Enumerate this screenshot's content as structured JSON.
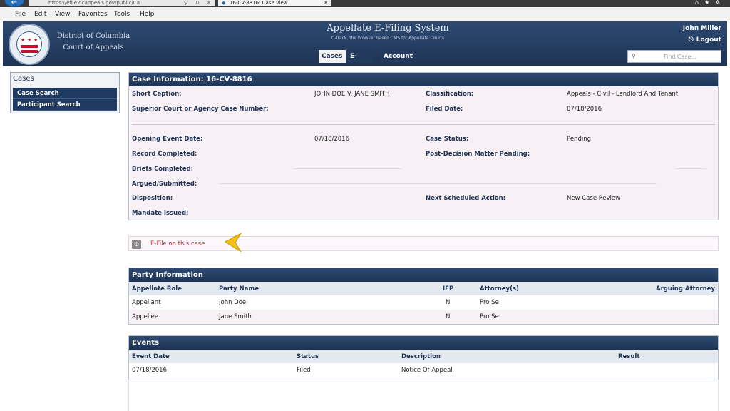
{
  "browser": {
    "address_text": "https://efile.dcappeals.gov/public/Ca",
    "tab_title": "16-CV-8816: Case View",
    "win_controls": "⌂★✲"
  },
  "menu": [
    "File",
    "Edit",
    "View",
    "Favorites",
    "Tools",
    "Help"
  ],
  "header": {
    "court_line1": "District of Columbia",
    "court_line2": "Court of Appeals",
    "app_title": "Appellate E-Filing System",
    "app_subtitle": "C-Track, the browser based CMS for Appellate Courts",
    "tabs": [
      "Cases",
      "E-Filing",
      "Account"
    ],
    "active_tab": "Cases",
    "user": "John Miller",
    "logout": "Logout",
    "find_case_placeholder": "Find Case..."
  },
  "sidebar": {
    "title": "Cases",
    "items": [
      "Case Search",
      "Participant Search"
    ]
  },
  "case_info": {
    "title": "Case Information: 16-CV-8816",
    "short_caption_label": "Short Caption:",
    "short_caption": "JOHN DOE V. JANE SMITH",
    "classification_label": "Classification:",
    "classification": "Appeals - Civil - Landlord And Tenant",
    "lower_court_label": "Superior Court or Agency Case Number:",
    "filed_date_label": "Filed Date:",
    "filed_date": "07/18/2016",
    "opening_event_label": "Opening Event Date:",
    "opening_event": "07/18/2016",
    "case_status_label": "Case Status:",
    "case_status": "Pending",
    "record_completed_label": "Record Completed:",
    "post_decision_label": "Post-Decision Matter Pending:",
    "briefs_completed_label": "Briefs Completed:",
    "argued_label": "Argued/Submitted:",
    "disposition_label": "Disposition:",
    "next_action_label": "Next Scheduled Action:",
    "next_action": "New Case Review",
    "mandate_label": "Mandate Issued:"
  },
  "efile": {
    "link": "E-File on this case"
  },
  "party_info": {
    "title": "Party Information",
    "columns": [
      "Appellate Role",
      "Party Name",
      "IFP",
      "Attorney(s)",
      "Arguing Attorney"
    ],
    "rows": [
      [
        "Appellant",
        "John Doe",
        "N",
        "Pro Se",
        ""
      ],
      [
        "Appellee",
        "Jane Smith",
        "N",
        "Pro Se",
        ""
      ]
    ]
  },
  "events": {
    "title": "Events",
    "columns": [
      "Event Date",
      "Status",
      "Description",
      "Result"
    ],
    "rows": [
      [
        "07/18/2016",
        "Filed",
        "Notice Of Appeal",
        ""
      ]
    ]
  }
}
